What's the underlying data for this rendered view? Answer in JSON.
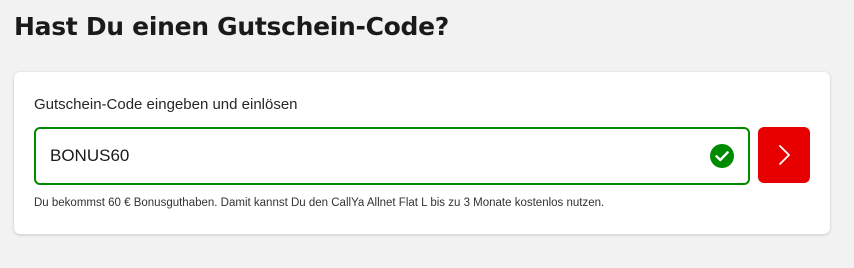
{
  "voucher": {
    "heading": "Hast Du einen Gutschein-Code?",
    "label": "Gutschein-Code eingeben und einlösen",
    "input_value": "BONUS60",
    "validation_icon": "check-circle-icon",
    "submit_icon": "chevron-right-icon",
    "helper_text": "Du bekommst 60 € Bonusguthaben. Damit kannst Du den CallYa Allnet Flat  L bis zu 3 Monate kostenlos nutzen."
  },
  "colors": {
    "page_background": "#f2f2f2",
    "accent_red": "#e60000",
    "success_green": "#008a00"
  }
}
